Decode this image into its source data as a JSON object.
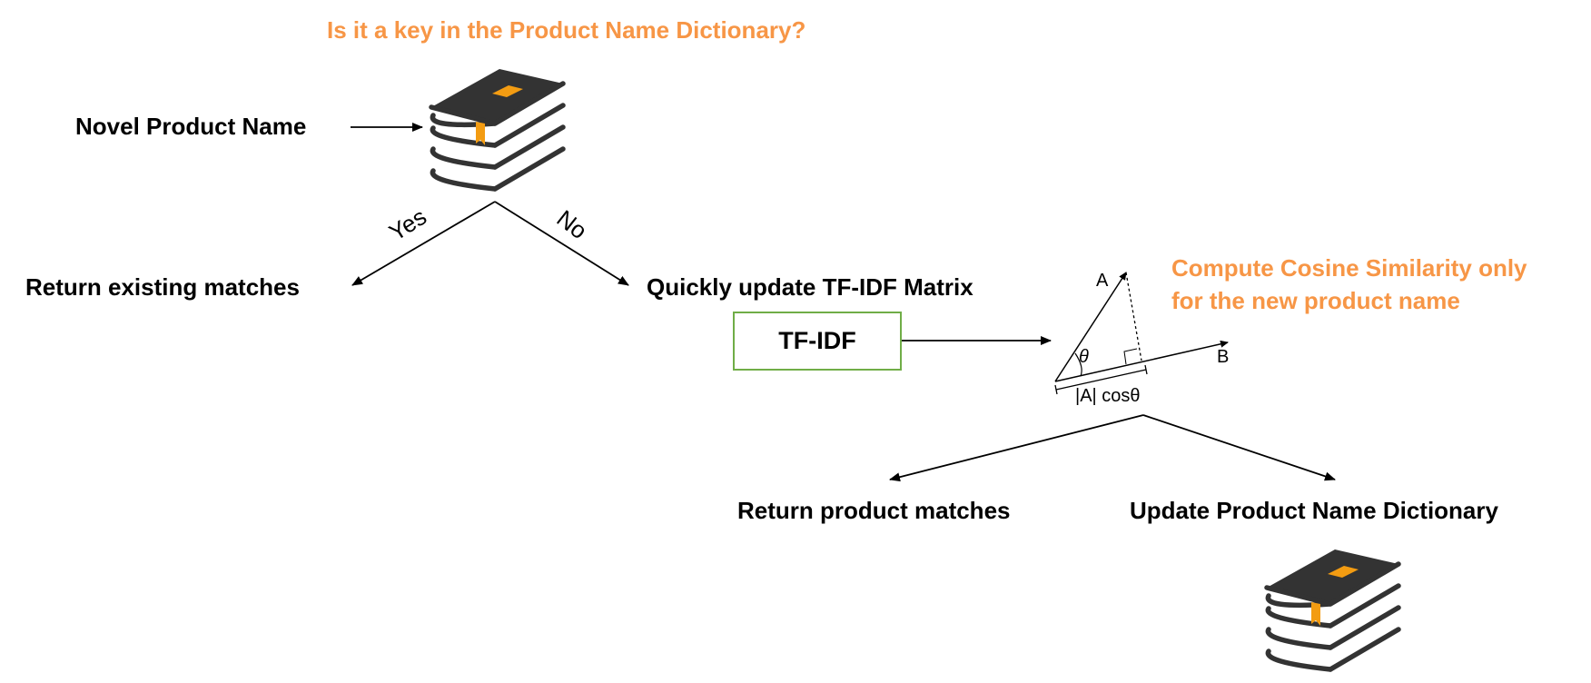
{
  "question_title": "Is it a key in the Product Name Dictionary?",
  "novel_product_name": "Novel Product Name",
  "branch_yes": "Yes",
  "branch_no": "No",
  "return_existing_matches": "Return existing matches",
  "quick_update": "Quickly update TF-IDF Matrix",
  "tfidf_box_label": "TF-IDF",
  "cosine_note": "Compute Cosine Similarity only\nfor the new product name",
  "vector_a_label": "A",
  "vector_b_label": "B",
  "theta_label": "θ",
  "projection_label": "|A| cosθ",
  "return_product_matches": "Return product matches",
  "update_dictionary": "Update Product Name Dictionary",
  "icons": {
    "dictionary_top": "book-stack-icon",
    "dictionary_bottom": "book-stack-icon"
  },
  "colors": {
    "accent_orange": "#F79646",
    "box_border_green": "#70AD47",
    "book_dark": "#333333",
    "bookmark": "#F39C12"
  }
}
